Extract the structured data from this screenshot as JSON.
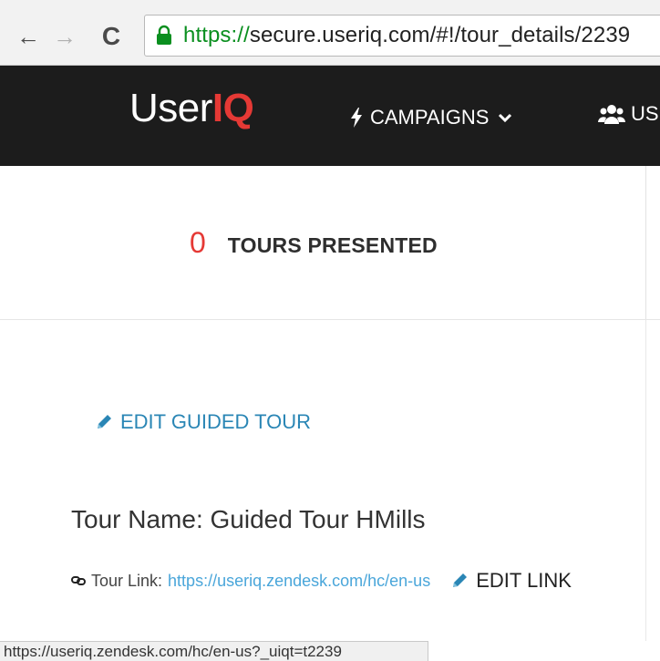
{
  "browser": {
    "url_scheme": "https://",
    "url_rest": "secure.useriq.com/#!/tour_details/2239",
    "back_icon": "←",
    "forward_icon": "→",
    "reload_icon": "C"
  },
  "app": {
    "logo_prefix": "User",
    "logo_suffix": "IQ",
    "nav_campaigns": "CAMPAIGNS",
    "nav_users": "US"
  },
  "stats": {
    "tours_presented_value": "0",
    "tours_presented_label": "TOURS PRESENTED"
  },
  "tour": {
    "edit_guided_tour": "EDIT GUIDED TOUR",
    "name_text": "Tour Name: Guided Tour HMills",
    "link_label": "Tour Link:",
    "link_url": "https://useriq.zendesk.com/hc/en-us",
    "edit_link": "EDIT LINK"
  },
  "status": {
    "hover_url": "https://useriq.zendesk.com/hc/en-us?_uiqt=t2239"
  },
  "colors": {
    "accent_red": "#e53935",
    "link_blue": "#2a86b5",
    "nav_bg": "#1c1c1c"
  },
  "icons": {
    "lock": "lock-icon",
    "bolt": "bolt-icon",
    "users": "users-icon",
    "pencil": "pencil-icon",
    "link": "link-icon",
    "chevron": "chevron-down-icon"
  }
}
